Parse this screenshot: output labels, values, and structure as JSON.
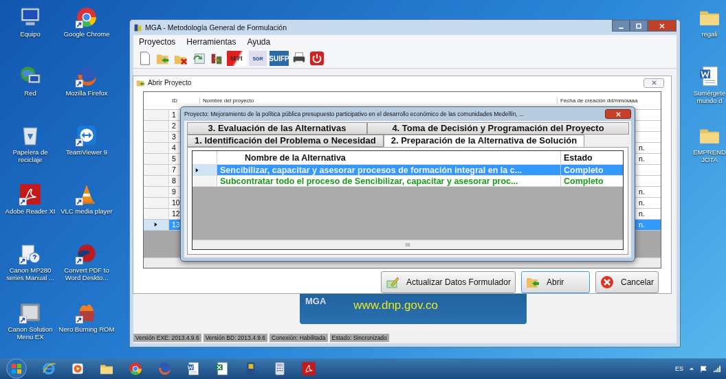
{
  "desktop_icons": [
    {
      "label": "Equipo",
      "kind": "computer",
      "shortcut": false
    },
    {
      "label": "Red",
      "kind": "network",
      "shortcut": false
    },
    {
      "label": "Papelera de reciclaje",
      "kind": "recycle",
      "shortcut": false
    },
    {
      "label": "Adobe Reader XI",
      "kind": "pdf",
      "shortcut": true
    },
    {
      "label": "Canon MP280 series Manual ...",
      "kind": "help",
      "shortcut": true
    },
    {
      "label": "Canon Solution Menu EX",
      "kind": "solution",
      "shortcut": true
    },
    {
      "label": "Google Chrome",
      "kind": "chrome",
      "shortcut": true
    },
    {
      "label": "Mozilla Firefox",
      "kind": "firefox",
      "shortcut": true
    },
    {
      "label": "TeamViewer 9",
      "kind": "teamviewer",
      "shortcut": true
    },
    {
      "label": "VLC media player",
      "kind": "vlc",
      "shortcut": true
    },
    {
      "label": "Convert PDF to Word Deskto...",
      "kind": "convert",
      "shortcut": true
    },
    {
      "label": "Nero Burning ROM",
      "kind": "nero",
      "shortcut": true
    }
  ],
  "desktop_icons_right": [
    {
      "label": "regali",
      "kind": "folder"
    },
    {
      "label": "Sumérgete mundo d",
      "kind": "word"
    },
    {
      "label": "EMPREND JOTA",
      "kind": "folder"
    }
  ],
  "window": {
    "title": "MGA - Metodología General de Formulación",
    "menu": [
      "Proyectos",
      "Herramientas",
      "Ayuda"
    ],
    "toolbar": [
      {
        "kind": "new"
      },
      {
        "kind": "open"
      },
      {
        "kind": "delete"
      },
      {
        "kind": "refresh"
      },
      {
        "kind": "tool"
      },
      {
        "kind": "sepi",
        "label": "SEPI"
      },
      {
        "kind": "sgr",
        "label": "SGR"
      },
      {
        "kind": "suifp",
        "label": "SUIFP"
      },
      {
        "kind": "print"
      },
      {
        "kind": "power"
      }
    ],
    "banner": {
      "logo": "MGA",
      "url": "www.dnp.gov.co"
    },
    "status_bar": [
      "Versión EXE: 2013.4.9.6",
      "Versión BD: 2013.4.9.6",
      "Conexión: Habilitada",
      "Estado: Sincronizado"
    ]
  },
  "open_project": {
    "title": "Abrir Proyecto",
    "columns": [
      "ID",
      "Nombre del proyecto",
      "Fecha de creación dd/mm/aaaa"
    ],
    "rows": [
      {
        "number": "1",
        "selected": false
      },
      {
        "number": "2",
        "selected": false
      },
      {
        "number": "3",
        "selected": false
      },
      {
        "number": "4",
        "date": "n.",
        "selected": false
      },
      {
        "number": "5",
        "date": "n.",
        "selected": false
      },
      {
        "number": "7",
        "selected": false
      },
      {
        "number": "8",
        "selected": false
      },
      {
        "number": "9",
        "date": "n.",
        "selected": false
      },
      {
        "number": "10",
        "date": "n.",
        "selected": false
      },
      {
        "number": "12",
        "date": "n.",
        "selected": false
      },
      {
        "number": "13",
        "date": "n.",
        "selected": true
      }
    ],
    "buttons": [
      {
        "label": "Actualizar Datos Formulador",
        "kind": "update",
        "default": false
      },
      {
        "label": "Abrir",
        "kind": "open",
        "default": true
      },
      {
        "label": "Cancelar",
        "kind": "cancel",
        "default": false
      }
    ]
  },
  "dialog": {
    "title": "Proyecto: Mejoramiento de la política pública presupuesto participativo en el desarrollo económico de las comunidades Medellín, ...",
    "tab_rows": [
      [
        {
          "label": "3. Evaluación de las Alternativas",
          "selected": false
        },
        {
          "label": "4. Toma de Decisión y Programación del Proyecto",
          "selected": false
        }
      ],
      [
        {
          "label": "1. Identificación del Problema o Necesidad",
          "selected": false
        },
        {
          "label": "2. Preparación de la Alternativa de Solución",
          "selected": true
        }
      ]
    ],
    "columns": [
      "Nombre de la Alternativa",
      "Estado"
    ],
    "rows": [
      {
        "name": "Sencibilizar, capacitar y asesorar procesos de formación integral en la c...",
        "estado": "Completo",
        "selected": true
      },
      {
        "name": "Subcontratar todo el proceso de Sencibilizar, capacitar y asesorar proc...",
        "estado": "Completo",
        "selected": false
      }
    ],
    "scroll_grip": "III"
  },
  "taskbar": {
    "apps": [
      {
        "kind": "ie"
      },
      {
        "kind": "media"
      },
      {
        "kind": "explorer"
      },
      {
        "kind": "chrome"
      },
      {
        "kind": "firefox"
      },
      {
        "kind": "word"
      },
      {
        "kind": "excel"
      },
      {
        "kind": "mga"
      },
      {
        "kind": "calc"
      },
      {
        "kind": "pdf"
      }
    ],
    "language": "ES"
  }
}
